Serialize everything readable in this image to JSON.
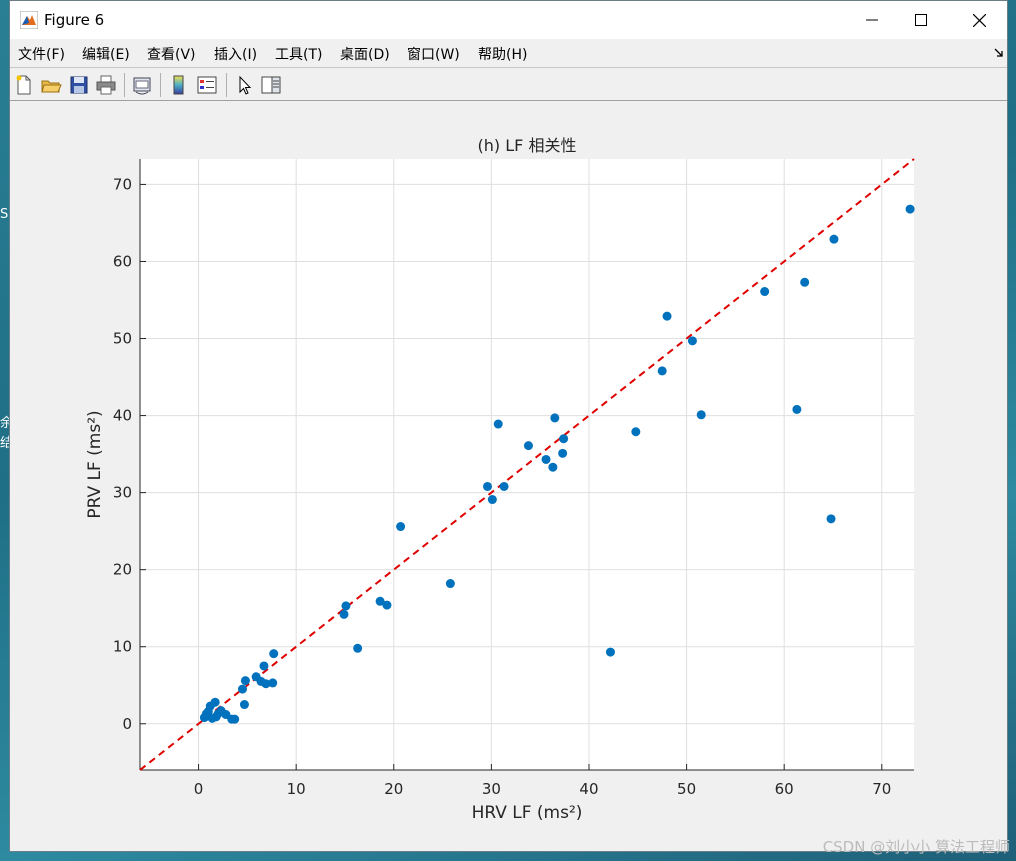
{
  "window": {
    "title": "Figure 6"
  },
  "menu": [
    "文件(F)",
    "编辑(E)",
    "查看(V)",
    "插入(I)",
    "工具(T)",
    "桌面(D)",
    "窗口(W)",
    "帮助(H)"
  ],
  "desktop_fragments": [
    "S",
    "余",
    "结"
  ],
  "watermark": "CSDN @刘小小 算法工程师",
  "chart_data": {
    "type": "scatter",
    "title": "(h) LF 相关性",
    "xlabel": "HRV LF (ms²)",
    "ylabel": "PRV LF (ms²)",
    "xlim": [
      -6,
      73.3
    ],
    "ylim": [
      -6,
      73.3
    ],
    "xticks": [
      0,
      10,
      20,
      30,
      40,
      50,
      60,
      70
    ],
    "yticks": [
      0,
      10,
      20,
      30,
      40,
      50,
      60,
      70
    ],
    "grid": true,
    "marker_color": "#0072bd",
    "reference_line": {
      "style": "dashed",
      "color": "#e00000",
      "from": [
        -6,
        -6
      ],
      "to": [
        73.3,
        73.3
      ]
    },
    "points": [
      [
        0.6,
        0.8
      ],
      [
        0.8,
        1.3
      ],
      [
        1.0,
        1.6
      ],
      [
        1.2,
        2.3
      ],
      [
        1.4,
        0.7
      ],
      [
        1.7,
        2.8
      ],
      [
        1.8,
        0.9
      ],
      [
        2.0,
        1.3
      ],
      [
        2.3,
        1.7
      ],
      [
        2.8,
        1.2
      ],
      [
        3.4,
        0.6
      ],
      [
        3.7,
        0.6
      ],
      [
        4.5,
        4.5
      ],
      [
        4.7,
        2.5
      ],
      [
        4.8,
        5.6
      ],
      [
        5.9,
        6.1
      ],
      [
        6.4,
        5.5
      ],
      [
        6.7,
        7.5
      ],
      [
        6.9,
        5.2
      ],
      [
        7.6,
        5.3
      ],
      [
        7.7,
        9.1
      ],
      [
        14.9,
        14.2
      ],
      [
        15.1,
        15.3
      ],
      [
        16.3,
        9.8
      ],
      [
        18.6,
        15.9
      ],
      [
        19.3,
        15.4
      ],
      [
        20.7,
        25.6
      ],
      [
        25.8,
        18.2
      ],
      [
        29.6,
        30.8
      ],
      [
        30.1,
        29.1
      ],
      [
        30.7,
        38.9
      ],
      [
        31.3,
        30.8
      ],
      [
        33.8,
        36.1
      ],
      [
        35.6,
        34.3
      ],
      [
        36.3,
        33.3
      ],
      [
        36.5,
        39.7
      ],
      [
        37.3,
        35.1
      ],
      [
        37.4,
        37.0
      ],
      [
        42.2,
        9.3
      ],
      [
        44.8,
        37.9
      ],
      [
        47.5,
        45.8
      ],
      [
        48.0,
        52.9
      ],
      [
        50.6,
        49.7
      ],
      [
        51.5,
        40.1
      ],
      [
        58.0,
        56.1
      ],
      [
        61.3,
        40.8
      ],
      [
        62.1,
        57.3
      ],
      [
        64.8,
        26.6
      ],
      [
        65.1,
        62.9
      ],
      [
        72.9,
        66.8
      ]
    ]
  }
}
